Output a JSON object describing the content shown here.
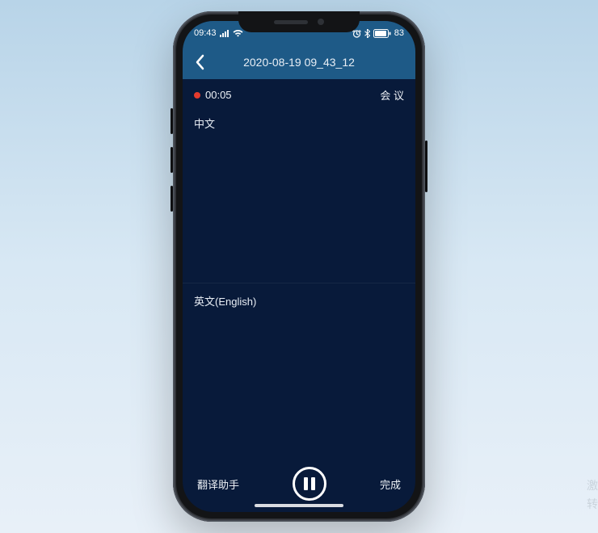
{
  "status": {
    "time": "09:43",
    "battery": "83"
  },
  "nav": {
    "title": "2020-08-19 09_43_12"
  },
  "record": {
    "elapsed": "00:05",
    "tag": "会 议"
  },
  "panes": {
    "source_label": "中文",
    "target_label": "英文(English)"
  },
  "bottom": {
    "left_label": "翻译助手",
    "right_label": "完成"
  },
  "watermark": {
    "line1": "激",
    "line2": "转"
  }
}
